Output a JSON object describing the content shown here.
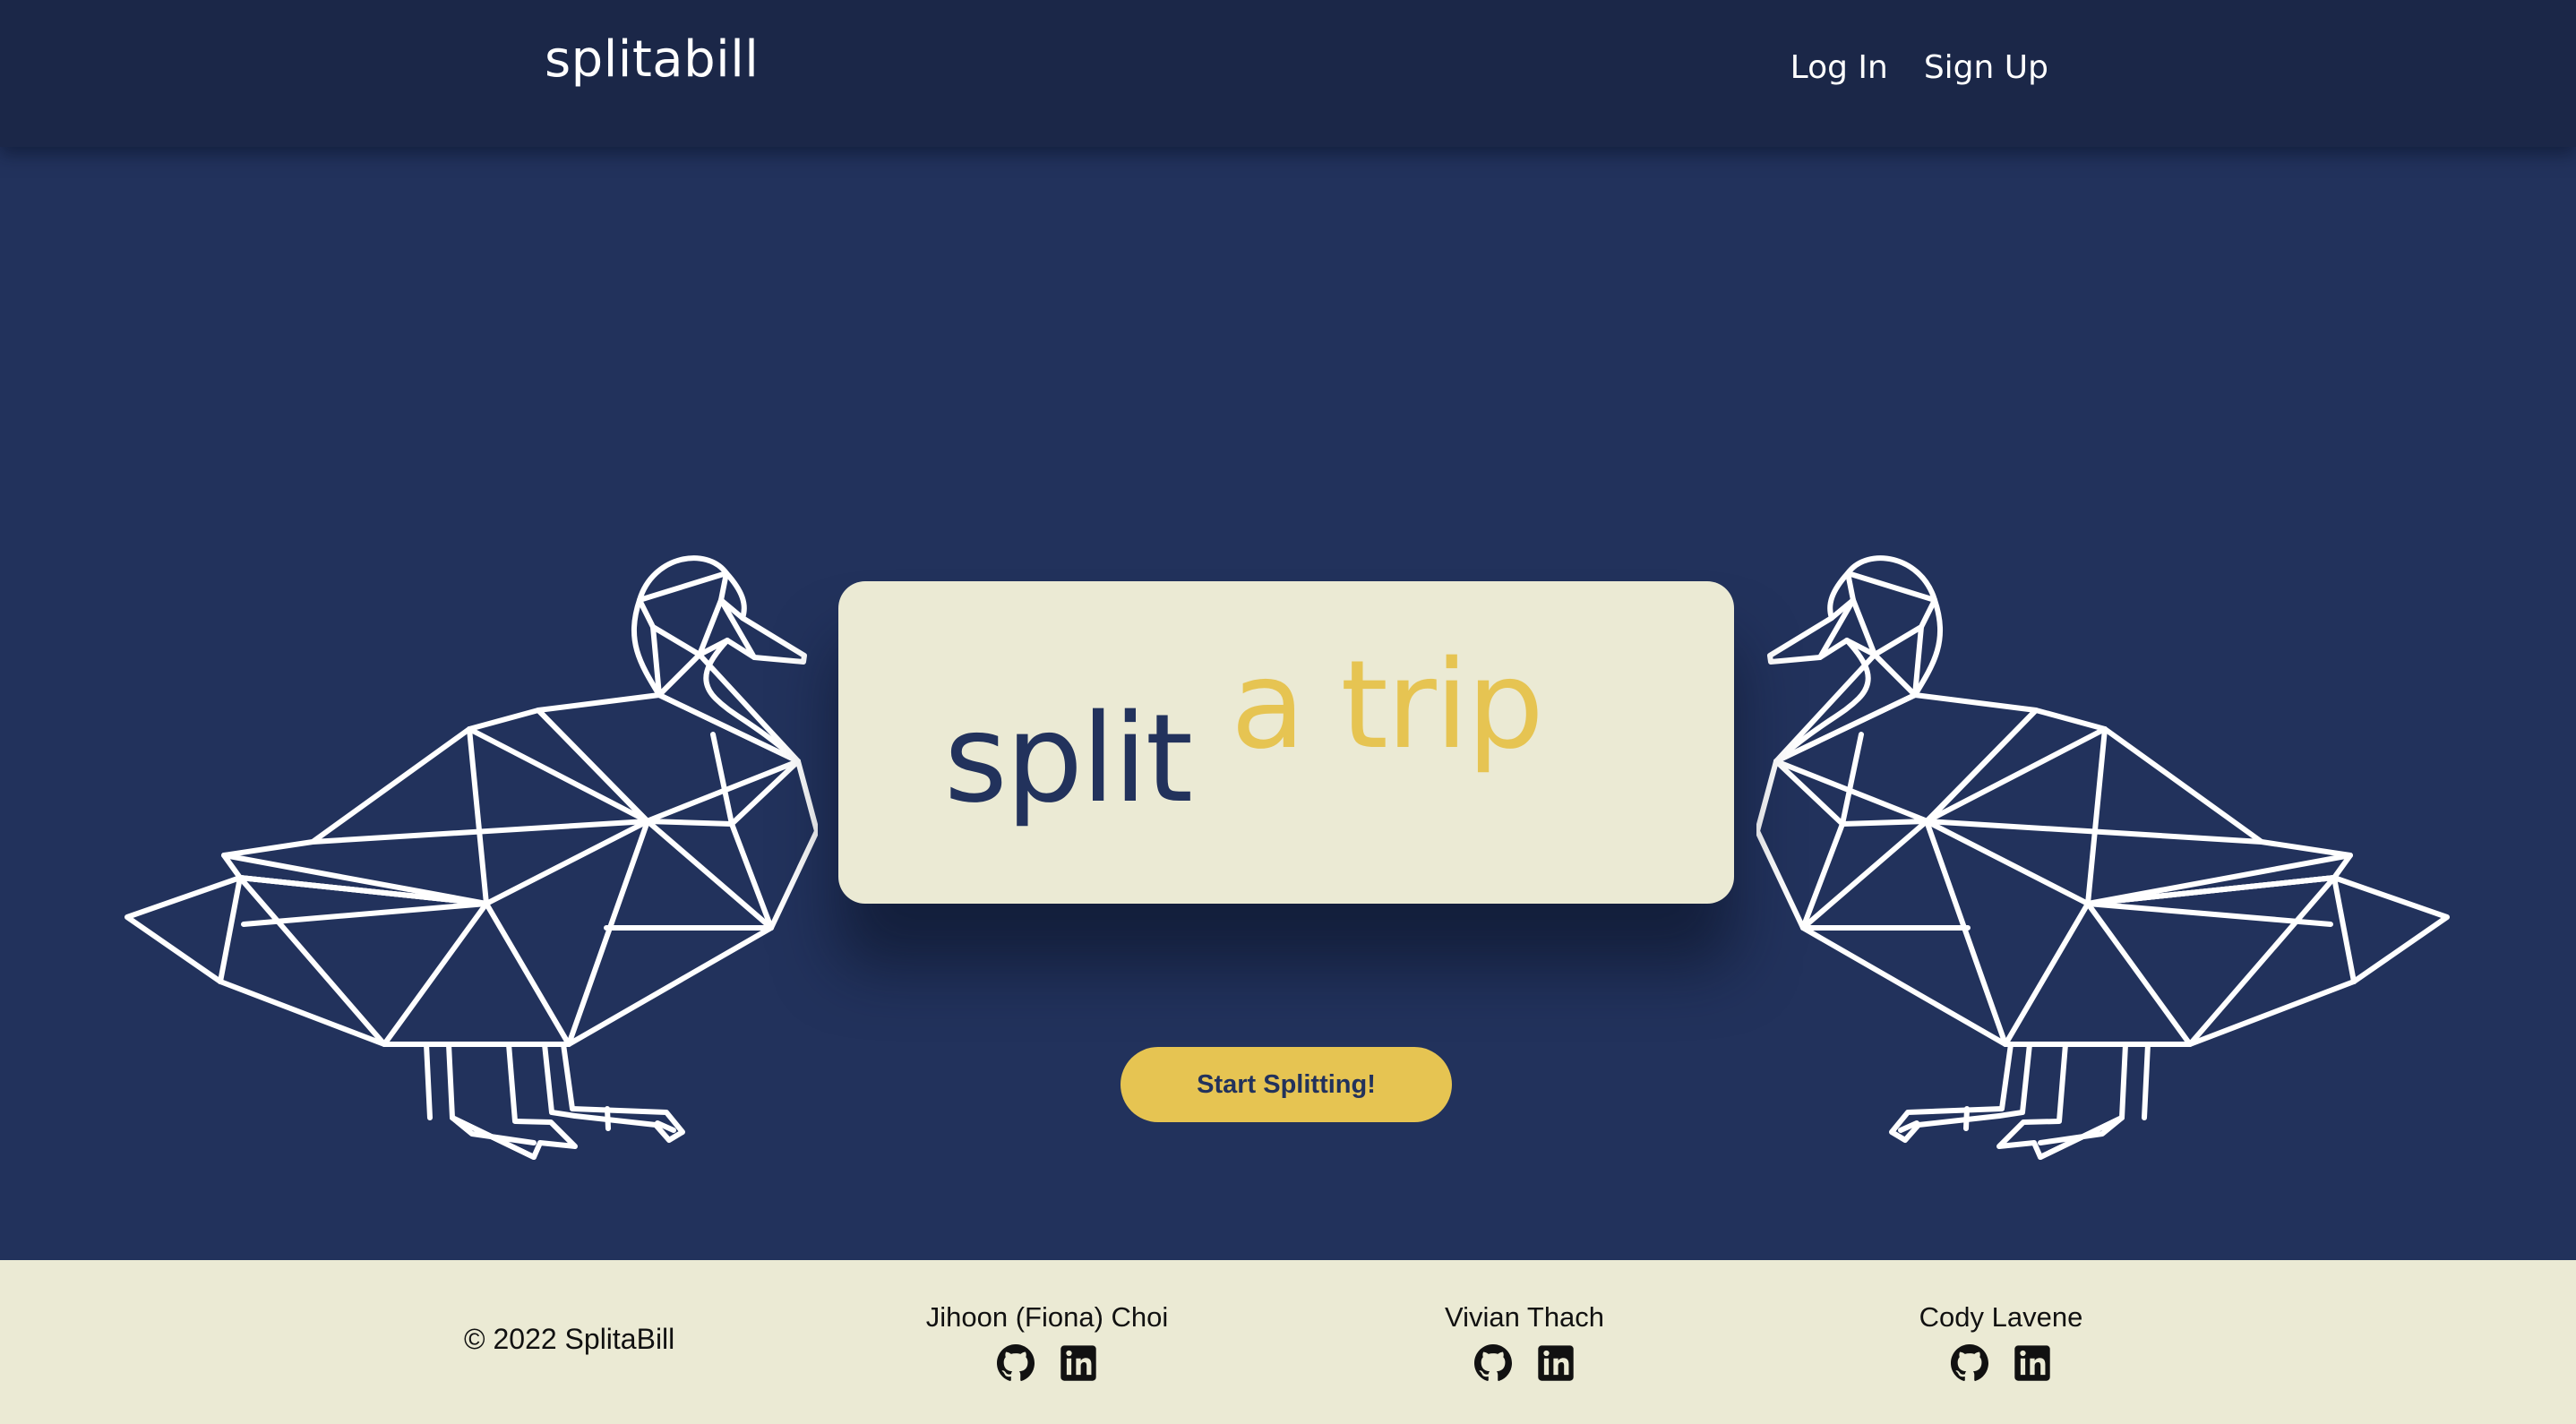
{
  "navbar": {
    "brand": "splitabill",
    "links": [
      {
        "label": "Log In"
      },
      {
        "label": "Sign Up"
      }
    ]
  },
  "hero": {
    "title_part1": "split",
    "title_part2": "a trip",
    "cta_label": "Start Splitting!",
    "decoration": "geometric-duck-outline"
  },
  "footer": {
    "copyright": "© 2022 SplitaBill",
    "members": [
      {
        "name": "Jihoon (Fiona) Choi",
        "icons": [
          "github-icon",
          "linkedin-icon"
        ]
      },
      {
        "name": "Vivian Thach",
        "icons": [
          "github-icon",
          "linkedin-icon"
        ]
      },
      {
        "name": "Cody Lavene",
        "icons": [
          "github-icon",
          "linkedin-icon"
        ]
      }
    ]
  },
  "colors": {
    "navbar_bg": "#1b2748",
    "hero_bg": "#22325c",
    "card_bg": "#ebead4",
    "accent_yellow": "#e6c452",
    "footer_bg": "#ebead4",
    "duck_stroke": "#ffffff"
  }
}
